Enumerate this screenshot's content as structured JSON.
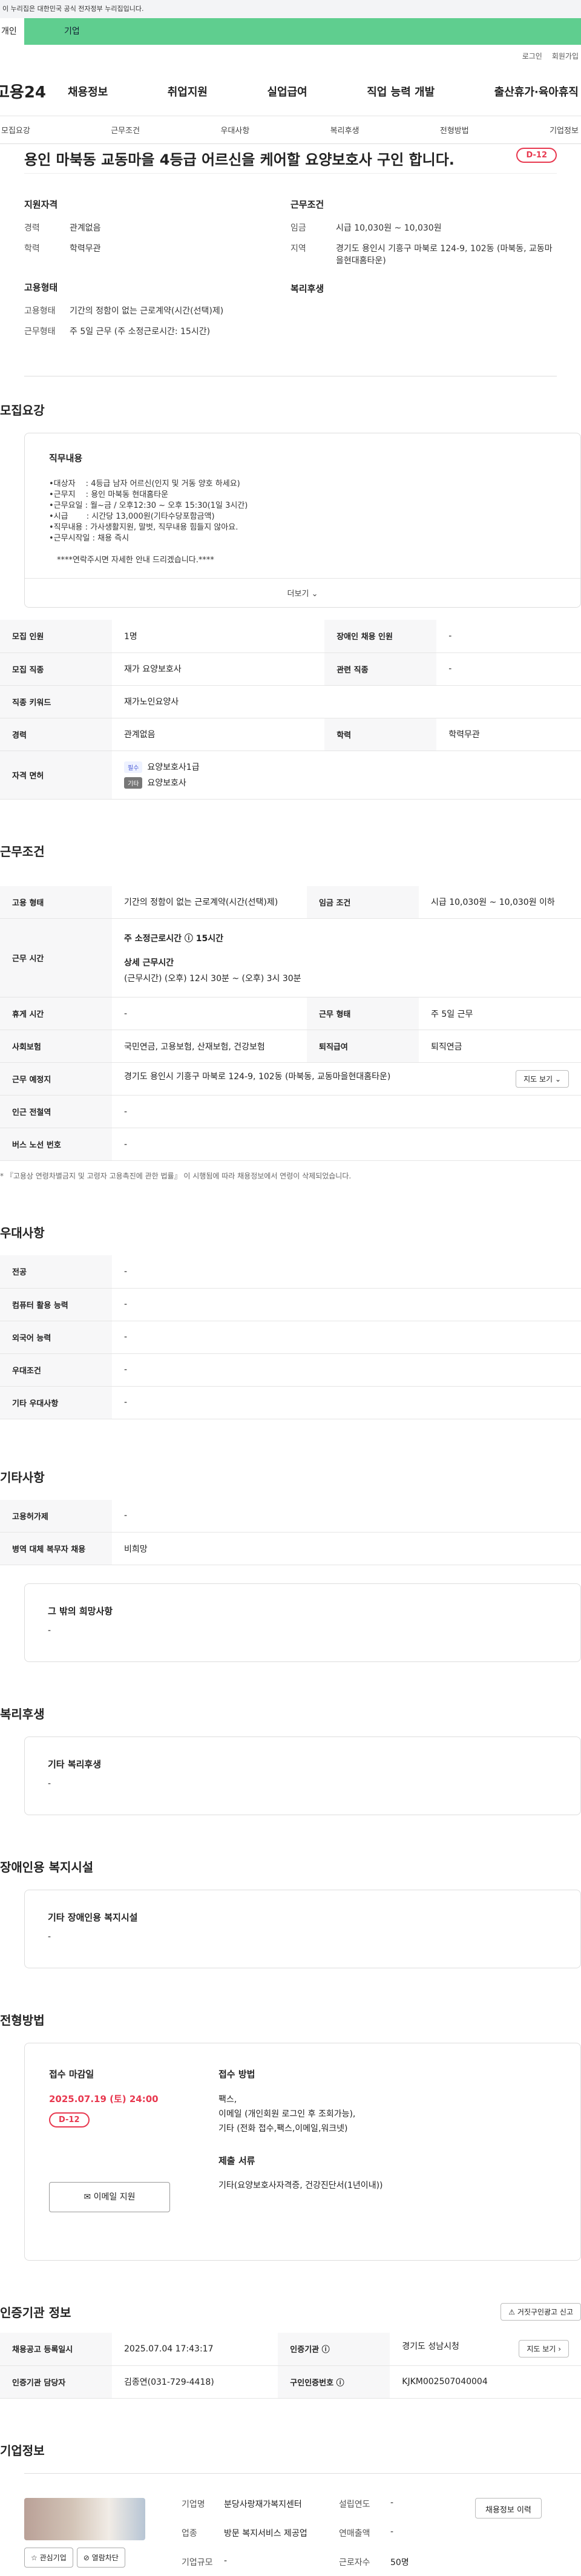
{
  "gov_banner": "이 누리집은 대한민국 공식 전자정부 누리집입니다.",
  "tabs": {
    "personal": "개인",
    "company": "기업"
  },
  "util": [
    "로그인",
    "회원가입"
  ],
  "logo": "고용24",
  "gnb": [
    "채용정보",
    "취업지원",
    "실업급여",
    "직업 능력 개발",
    "출산휴가·육아휴직"
  ],
  "anchors": [
    "모집요강",
    "근무조건",
    "우대사항",
    "복리후생",
    "전형방법",
    "기업정보"
  ],
  "job": {
    "title": "용인 마북동 교동마을 4등급 어르신을 케어할 요양보호사 구인 합니다.",
    "dday": "D-12"
  },
  "summary": {
    "qual_h": "지원자격",
    "career_k": "경력",
    "career_v": "관계없음",
    "edu_k": "학력",
    "edu_v": "학력무관",
    "cond_h": "근무조건",
    "wage_k": "임금",
    "wage_v": "시급 10,030원 ~ 10,030원",
    "region_k": "지역",
    "region_v": "경기도 용인시 기흥구 마북로 124-9, 102동 (마북동, 교동마을현대홈타운)",
    "emp_h": "고용형태",
    "emptype_k": "고용형태",
    "emptype_v": "기간의 정함이 없는 근로계약(시간(선택)제)",
    "worktype_k": "근무형태",
    "worktype_v": "주 5일 근무 (주 소정근로시간: 15시간)",
    "welfare_h": "복리후생"
  },
  "recruit": {
    "section_title": "모집요강",
    "duty_h": "직무내용",
    "duty_lines": [
      "•대상자 　: 4등급 남자 어르신(인지 및 거동 양호 하세요)",
      "•근무지 　: 용인 마북동 현대홈타운",
      "•근무요일 : 월~금 / 오후12:30 ~ 오후 15:30(1일 3시간)",
      "•시급 　　: 시간당 13,000원(기타수당포함금액)",
      "•직무내용 : 가사생활지원, 말벗, 직무내용 힘들지 않아요.",
      "•근무시작일 : 채용 즉시",
      "",
      "　****연락주시면 자세한 안내 드리겠습니다.****"
    ],
    "more": "더보기",
    "rows": {
      "headcount_k": "모집 인원",
      "headcount_v": "1명",
      "disabled_k": "장애인 채용 인원",
      "disabled_v": "-",
      "job_k": "모집 직종",
      "job_v": "재가 요양보호사",
      "related_k": "관련 직종",
      "related_v": "-",
      "keyword_k": "직종 키워드",
      "keyword_v": "재가노인요양사",
      "career_k": "경력",
      "career_v": "관계없음",
      "edu_k": "학력",
      "edu_v": "학력무관",
      "license_k": "자격 면허",
      "license_badge1": "필수",
      "license1": "요양보호사1급",
      "license_badge2": "기타",
      "license2": "요양보호사"
    }
  },
  "work": {
    "section_title": "근무조건",
    "emptype_k": "고용 형태",
    "emptype_v": "기간의 정함이 없는 근로계약(시간(선택)제)",
    "wage_k": "임금 조건",
    "wage_v": "시급 10,030원 ~ 10,030원 이하",
    "time_k": "근무 시간",
    "time_weekly": "주 소정근로시간 ⓘ 15시간",
    "time_detail_h": "상세 근무시간",
    "time_detail": "(근무시간) (오후) 12시 30분 ~ (오후) 3시 30분",
    "rest_k": "휴게 시간",
    "rest_v": "-",
    "form_k": "근무 형태",
    "form_v": "주 5일 근무",
    "insurance_k": "사회보험",
    "insurance_v": "국민연금, 고용보험, 산재보험, 건강보험",
    "retire_k": "퇴직급여",
    "retire_v": "퇴직연금",
    "place_k": "근무 예정지",
    "place_v": "경기도 용인시 기흥구 마북로 124-9, 102동 (마북동, 교동마을현대홈타운)",
    "map": "지도 보기",
    "subway_k": "인근 전철역",
    "subway_v": "-",
    "bus_k": "버스 노선 번호",
    "bus_v": "-",
    "note": "* 『고용상 연령차별금지 및 고령자 고용촉진에 관한 법률』 이 시행됨에 따라 채용정보에서 연령이 삭제되었습니다."
  },
  "pref": {
    "section_title": "우대사항",
    "rows": [
      {
        "k": "전공",
        "v": "-"
      },
      {
        "k": "컴퓨터 활용 능력",
        "v": "-"
      },
      {
        "k": "외국어 능력",
        "v": "-"
      },
      {
        "k": "우대조건",
        "v": "-"
      },
      {
        "k": "기타 우대사항",
        "v": "-"
      }
    ]
  },
  "etc": {
    "section_title": "기타사항",
    "rows": [
      {
        "k": "고용허가제",
        "v": "-"
      },
      {
        "k": "병역 대체 복무자 채용",
        "v": "비희망"
      }
    ],
    "other_h": "그 밖의 희망사항",
    "other_v": "-"
  },
  "welfare": {
    "section_title": "복리후생",
    "h": "기타 복리후생",
    "v": "-"
  },
  "disabled": {
    "section_title": "장애인용 복지시설",
    "h": "기타 장애인용 복지시설",
    "v": "-"
  },
  "apply": {
    "section_title": "전형방법",
    "deadline_h": "접수 마감일",
    "deadline": "2025.07.19 (토) 24:00",
    "dday": "D-12",
    "email": "이메일 지원",
    "method_h": "접수 방법",
    "method_lines": [
      "팩스,",
      "이메일 (개인회원 로그인 후 조회가능),",
      "기타 (전화 접수,팩스,이메일,워크넷)"
    ],
    "docs_h": "제출 서류",
    "docs_v": "기타(요양보호사자격증, 건강진단서(1년이내))"
  },
  "cert": {
    "section_title": "인증기관 정보",
    "report": "거짓구인광고 신고",
    "reg_k": "채용공고 등록일시",
    "reg_v": "2025.07.04 17:43:17",
    "agency_k": "인증기관 ⓘ",
    "agency_v": "경기도 성남시청",
    "map": "지도 보기",
    "manager_k": "인증기관 담당자",
    "manager_v": "김종연(031-729-4418)",
    "notice_k": "구인인증번호 ⓘ",
    "notice_v": "KJKM002507040004"
  },
  "company": {
    "section_title": "기업정보",
    "fav": "관심기업",
    "block": "열람차단",
    "name_k": "기업명",
    "name_v": "분당사랑재가복지센터",
    "industry_k": "업종",
    "industry_v": "방문 복지서비스 제공업",
    "size_k": "기업규모",
    "size_v": "-",
    "founded_k": "설립연도",
    "founded_v": "-",
    "sales_k": "연매출액",
    "sales_v": "-",
    "employees_k": "근로자수",
    "employees_v": "50명",
    "info_btn": "채용정보 이력"
  }
}
